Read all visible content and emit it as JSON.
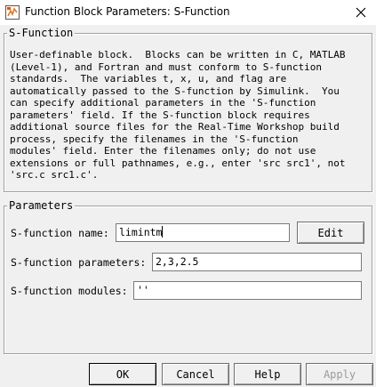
{
  "window": {
    "title": "Function Block Parameters: S-Function"
  },
  "icons": {
    "app": "simulink-block-icon",
    "close": "close-icon"
  },
  "sfunction_group": {
    "legend": "S-Function",
    "description_lines": [
      "User-definable block.  Blocks can be written in C, MATLAB",
      "(Level-1), and Fortran and must conform to S-function",
      "standards.  The variables t, x, u, and flag are",
      "automatically passed to the S-function by Simulink.  You",
      "can specify additional parameters in the 'S-function",
      "parameters' field. If the S-function block requires",
      "additional source files for the Real-Time Workshop build",
      "process, specify the filenames in the 'S-function",
      "modules' field. Enter the filenames only; do not use",
      "extensions or full pathnames, e.g., enter 'src src1', not",
      "'src.c src1.c'."
    ]
  },
  "parameters_group": {
    "legend": "Parameters",
    "name_label": "S-function name:",
    "name_value": "limintm",
    "edit_button": "Edit",
    "params_label": "S-function parameters:",
    "params_value": "2,3,2.5",
    "modules_label": "S-function modules:",
    "modules_value": "''"
  },
  "footer": {
    "ok": "OK",
    "cancel": "Cancel",
    "help": "Help",
    "apply": "Apply"
  },
  "colors": {
    "background": "#f0f0f0",
    "titlebar": "#ffffff",
    "disabled_text": "#9a9a9a",
    "icon_orange": "#e07a1f"
  }
}
